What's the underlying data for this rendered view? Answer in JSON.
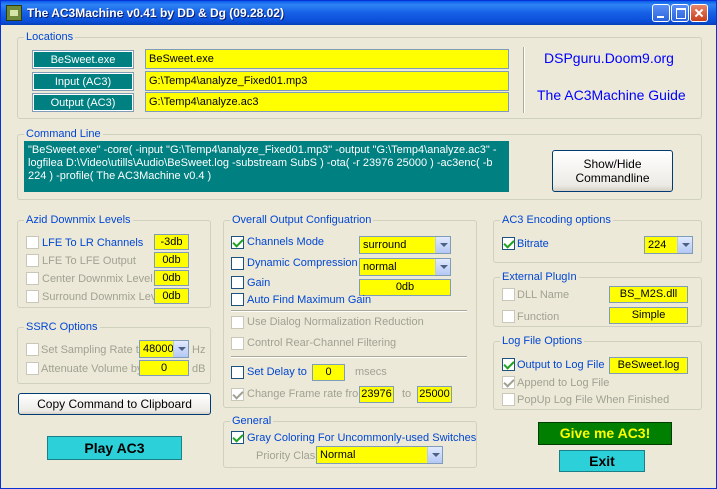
{
  "window": {
    "title": "The AC3Machine v0.41 by DD & Dg (09.28.02)"
  },
  "locations": {
    "legend": "Locations",
    "besweet_label": "BeSweet.exe",
    "besweet_value": "BeSweet.exe",
    "input_label": "Input (AC3)",
    "input_value": "G:\\Temp4\\analyze_Fixed01.mp3",
    "output_label": "Output (AC3)",
    "output_value": "G:\\Temp4\\analyze.ac3",
    "link1": "DSPguru.Doom9.org",
    "link2": "The AC3Machine Guide"
  },
  "command_line": {
    "legend": "Command Line",
    "text": "\"BeSweet.exe\" -core( -input \"G:\\Temp4\\analyze_Fixed01.mp3\" -output \"G:\\Temp4\\analyze.ac3\" -logfilea D:\\Video\\utills\\Audio\\BeSweet.log -substream SubS ) -ota( -r 23976 25000 ) -ac3enc( -b 224 ) -profile( The AC3Machine v0.4 )",
    "toggle_button": "Show/Hide Commandline"
  },
  "azid": {
    "legend": "Azid Downmix Levels",
    "rows": [
      {
        "label": "LFE To LR Channels",
        "value": "-3db",
        "enabled": true
      },
      {
        "label": "LFE To LFE Output",
        "value": "0db",
        "enabled": false
      },
      {
        "label": "Center Downmix Level",
        "value": "0db",
        "enabled": false
      },
      {
        "label": "Surround Downmix Level",
        "value": "0db",
        "enabled": false
      }
    ]
  },
  "ssrc": {
    "legend": "SSRC Options",
    "sampling_label": "Set Sampling Rate to",
    "sampling_value": "48000",
    "sampling_unit": "Hz",
    "attenuate_label": "Attenuate Volume by",
    "attenuate_value": "0",
    "attenuate_unit": "dB"
  },
  "copy_button": "Copy Command to Clipboard",
  "play_button": "Play AC3",
  "overall": {
    "legend": "Overall Output Configuatrion",
    "channels_mode_label": "Channels Mode",
    "channels_mode_value": "surround",
    "dynamic_compression_label": "Dynamic Compression",
    "dynamic_compression_value": "normal",
    "gain_label": "Gain",
    "gain_value": "0db",
    "auto_gain_label": "Auto Find Maximum Gain",
    "dialog_norm_label": "Use Dialog Normalization Reduction",
    "control_rear_label": "Control Rear-Channel Filtering",
    "delay_label": "Set Delay to",
    "delay_value": "0",
    "delay_unit": "msecs",
    "frame_rate_label": "Change Frame rate from",
    "frame_rate_from": "23976",
    "frame_rate_to_label": "to",
    "frame_rate_to": "25000"
  },
  "general": {
    "legend": "General",
    "gray_coloring_label": "Gray Coloring For Uncommonly-used Switches",
    "priority_label": "Priority Class",
    "priority_value": "Normal"
  },
  "ac3_encoding": {
    "legend": "AC3 Encoding options",
    "bitrate_label": "Bitrate",
    "bitrate_value": "224"
  },
  "external_plugin": {
    "legend": "External PlugIn",
    "dll_label": "DLL Name",
    "dll_value": "BS_M2S.dll",
    "function_label": "Function",
    "function_value": "Simple"
  },
  "log_file": {
    "legend": "Log File Options",
    "output_label": "Output to Log File",
    "output_value": "BeSweet.log",
    "append_label": "Append to Log File",
    "popup_label": "PopUp Log File When Finished"
  },
  "give_button": "Give me AC3!",
  "exit_button": "Exit"
}
